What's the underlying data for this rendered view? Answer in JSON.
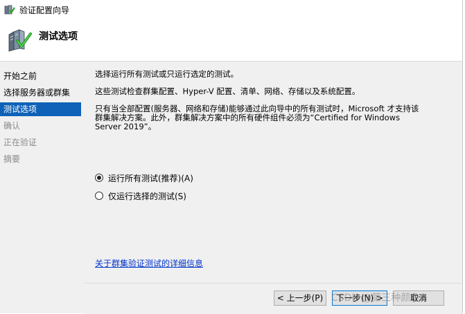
{
  "window": {
    "title": "验证配置向导"
  },
  "header": {
    "page_title": "测试选项"
  },
  "sidebar": {
    "items": [
      {
        "label": "开始之前",
        "state": "normal"
      },
      {
        "label": "选择服务器或群集",
        "state": "normal"
      },
      {
        "label": "测试选项",
        "state": "active"
      },
      {
        "label": "确认",
        "state": "disabled"
      },
      {
        "label": "正在验证",
        "state": "disabled"
      },
      {
        "label": "摘要",
        "state": "disabled"
      }
    ]
  },
  "main": {
    "intro": "选择运行所有测试或只运行选定的测试。",
    "description": "这些测试检查群集配置、Hyper-V 配置、清单、网络、存储以及系统配置。",
    "support_line1": "只有当全部配置(服务器、网络和存储)能够通过此向导中的所有测试时，Microsoft 才支持该",
    "support_line2": "群集解决方案。此外，群集解决方案中的所有硬件组件必须为“Certified for Windows",
    "support_line3": "Server 2019”。",
    "options": [
      {
        "label": "运行所有测试(推荐)(A)",
        "checked": true
      },
      {
        "label": "仅运行选择的测试(S)",
        "checked": false
      }
    ],
    "help_link": "关于群集验证测试的详细信息"
  },
  "footer": {
    "back_label": "< 上一步(P)",
    "next_label": "下一步(N) >",
    "cancel_label": "取消"
  },
  "watermark": "CSDN @第三种颜色0",
  "colors": {
    "accent": "#0f62b8",
    "link": "#0033cc",
    "panel": "#f0f0f0"
  }
}
